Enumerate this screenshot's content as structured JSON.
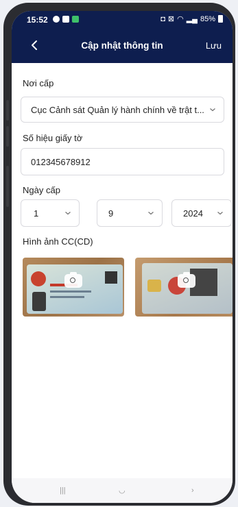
{
  "status_bar": {
    "time": "15:52",
    "battery": "85%"
  },
  "header": {
    "title": "Cập nhật thông tin",
    "save_label": "Lưu",
    "background": "#0e1e4f"
  },
  "form": {
    "issuer": {
      "label": "Nơi cấp",
      "value": "Cục Cảnh sát Quản lý hành chính về trật t..."
    },
    "doc_number": {
      "label": "Số hiệu giấy tờ",
      "value": "012345678912"
    },
    "issue_date": {
      "label": "Ngày cấp",
      "day": "1",
      "month": "9",
      "year": "2024"
    },
    "images": {
      "label": "Hình ảnh CC(CD)",
      "front_icon": "camera-icon",
      "back_icon": "camera-icon"
    }
  }
}
